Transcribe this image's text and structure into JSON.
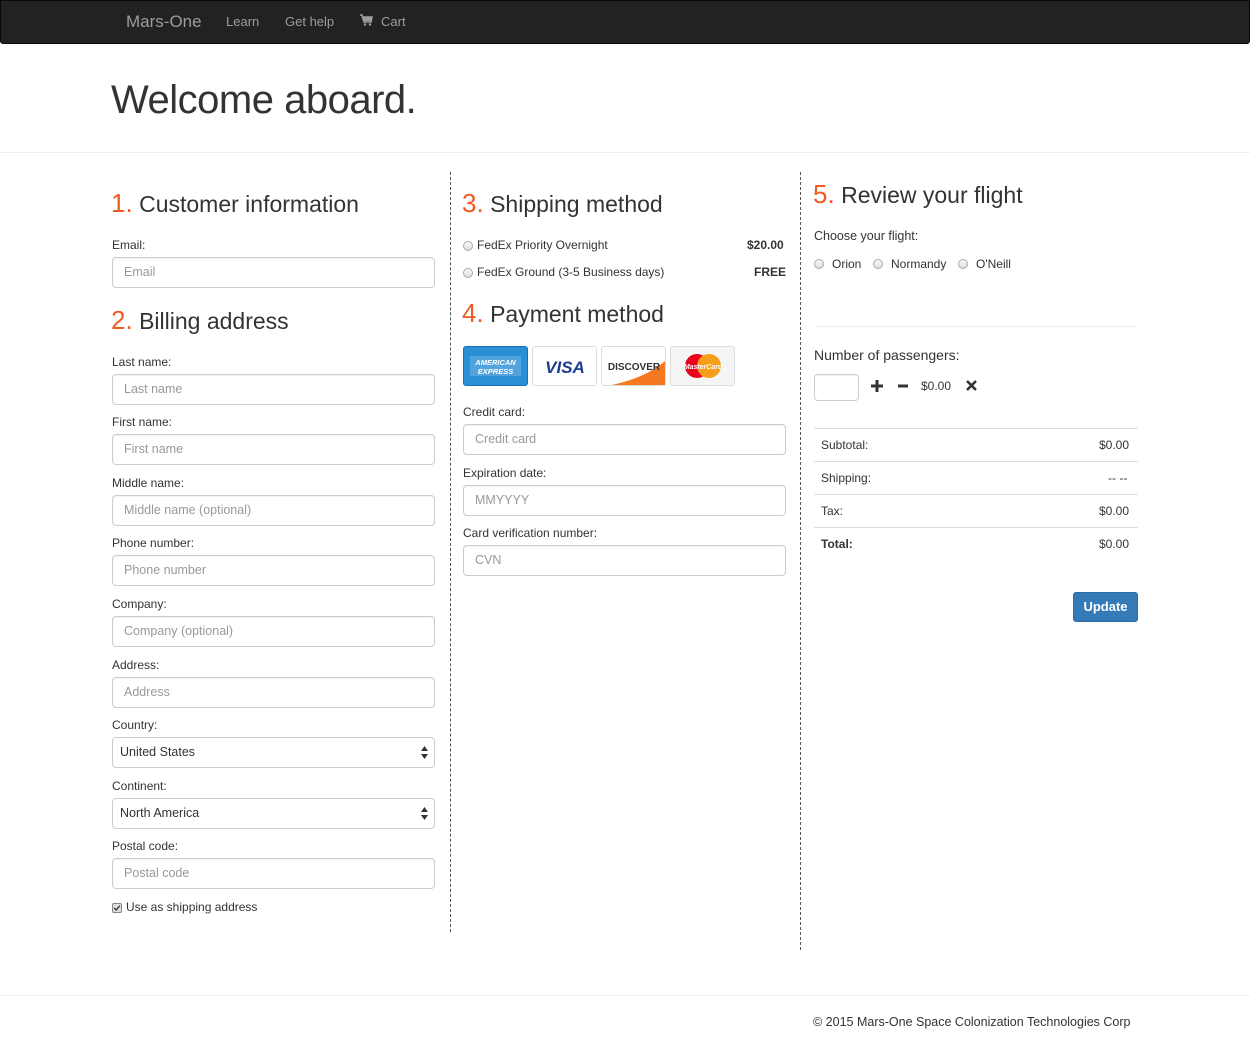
{
  "nav": {
    "brand": "Mars-One",
    "learn": "Learn",
    "help": "Get help",
    "cart": "Cart",
    "cart_icon": "shopping-cart-icon"
  },
  "headline": "Welcome aboard.",
  "customer": {
    "num": "1.",
    "title": "Customer information",
    "email_label": "Email:",
    "email_placeholder": "Email"
  },
  "billing": {
    "num": "2.",
    "title": "Billing address",
    "last_label": "Last name:",
    "last_placeholder": "Last name",
    "first_label": "First name:",
    "first_placeholder": "First name",
    "middle_label": "Middle name:",
    "middle_placeholder": "Middle name (optional)",
    "phone_label": "Phone number:",
    "phone_placeholder": "Phone number",
    "company_label": "Company:",
    "company_placeholder": "Company (optional)",
    "address_label": "Address:",
    "address_placeholder": "Address",
    "country_label": "Country:",
    "country_value": "United States",
    "continent_label": "Continent:",
    "continent_value": "North America",
    "postal_label": "Postal code:",
    "postal_placeholder": "Postal code",
    "shipping_checkbox": "Use as shipping address"
  },
  "shipping": {
    "num": "3.",
    "title": "Shipping method",
    "options": [
      {
        "label": "FedEx Priority Overnight",
        "price": "$20.00"
      },
      {
        "label": "FedEx Ground (3-5 Business days)",
        "price": "FREE"
      }
    ]
  },
  "payment": {
    "num": "4.",
    "title": "Payment method",
    "cards": [
      {
        "name": "amex-card-icon",
        "line1": "AMERICAN",
        "line2": "EXPRESS",
        "color": "#2b8fd6"
      },
      {
        "name": "visa-card-icon",
        "text": "VISA",
        "color": "#1a3d8f"
      },
      {
        "name": "discover-card-icon",
        "text": "DISCOVER",
        "color": "#f47920"
      },
      {
        "name": "mastercard-card-icon",
        "text": "MasterCard",
        "color1": "#eb001b",
        "color2": "#f79e1b"
      }
    ],
    "cc_label": "Credit card:",
    "cc_placeholder": "Credit card",
    "exp_label": "Expiration date:",
    "exp_placeholder": "MMYYYY",
    "cvn_label": "Card verification number:",
    "cvn_placeholder": "CVN"
  },
  "review": {
    "num": "5.",
    "title": "Review your flight",
    "choose_label": "Choose your flight:",
    "flights": [
      "Orion",
      "Normandy",
      "O'Neill"
    ],
    "passengers_label": "Number of passengers:",
    "passenger_price": "$0.00",
    "rows": [
      {
        "label": "Subtotal:",
        "value": "$0.00"
      },
      {
        "label": "Shipping:",
        "value": "-- --"
      },
      {
        "label": "Tax:",
        "value": "$0.00"
      },
      {
        "label": "Total:",
        "value": "$0.00"
      }
    ],
    "update": "Update"
  },
  "footer": "© 2015 Mars-One Space Colonization Technologies Corp",
  "colors": {
    "accent": "#f05a22",
    "navbar": "#222222",
    "button": "#337ab7"
  }
}
